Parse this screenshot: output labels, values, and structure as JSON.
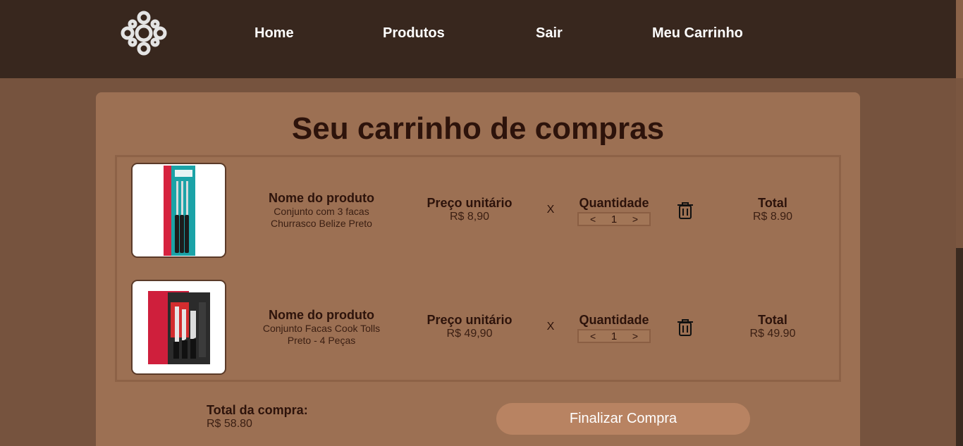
{
  "nav": {
    "links": [
      "Home",
      "Produtos",
      "Sair",
      "Meu Carrinho"
    ]
  },
  "cart": {
    "title": "Seu carrinho de compras",
    "name_header": "Nome do produto",
    "price_header": "Preço unitário",
    "qty_header": "Quantidade",
    "total_header": "Total",
    "times_symbol": "X",
    "items": [
      {
        "name_line1": "Conjunto com 3 facas",
        "name_line2": "Churrasco Belize Preto",
        "unit_price": "R$ 8,90",
        "quantity": "1",
        "total": "R$ 8.90"
      },
      {
        "name_line1": "Conjunto Facas Cook Tolls",
        "name_line2": "Preto - 4 Peças",
        "unit_price": "R$ 49,90",
        "quantity": "1",
        "total": "R$ 49.90"
      }
    ],
    "stepper_dec": "<",
    "stepper_inc": ">",
    "grand_total_label": "Total da compra:",
    "grand_total_value": "R$ 58.80",
    "checkout_label": "Finalizar Compra"
  },
  "colors": {
    "header_bg": "#38271e",
    "page_bg": "#76533e",
    "card_bg": "#9c7053",
    "title_text": "#2d130b",
    "button_bg": "#b88362"
  }
}
